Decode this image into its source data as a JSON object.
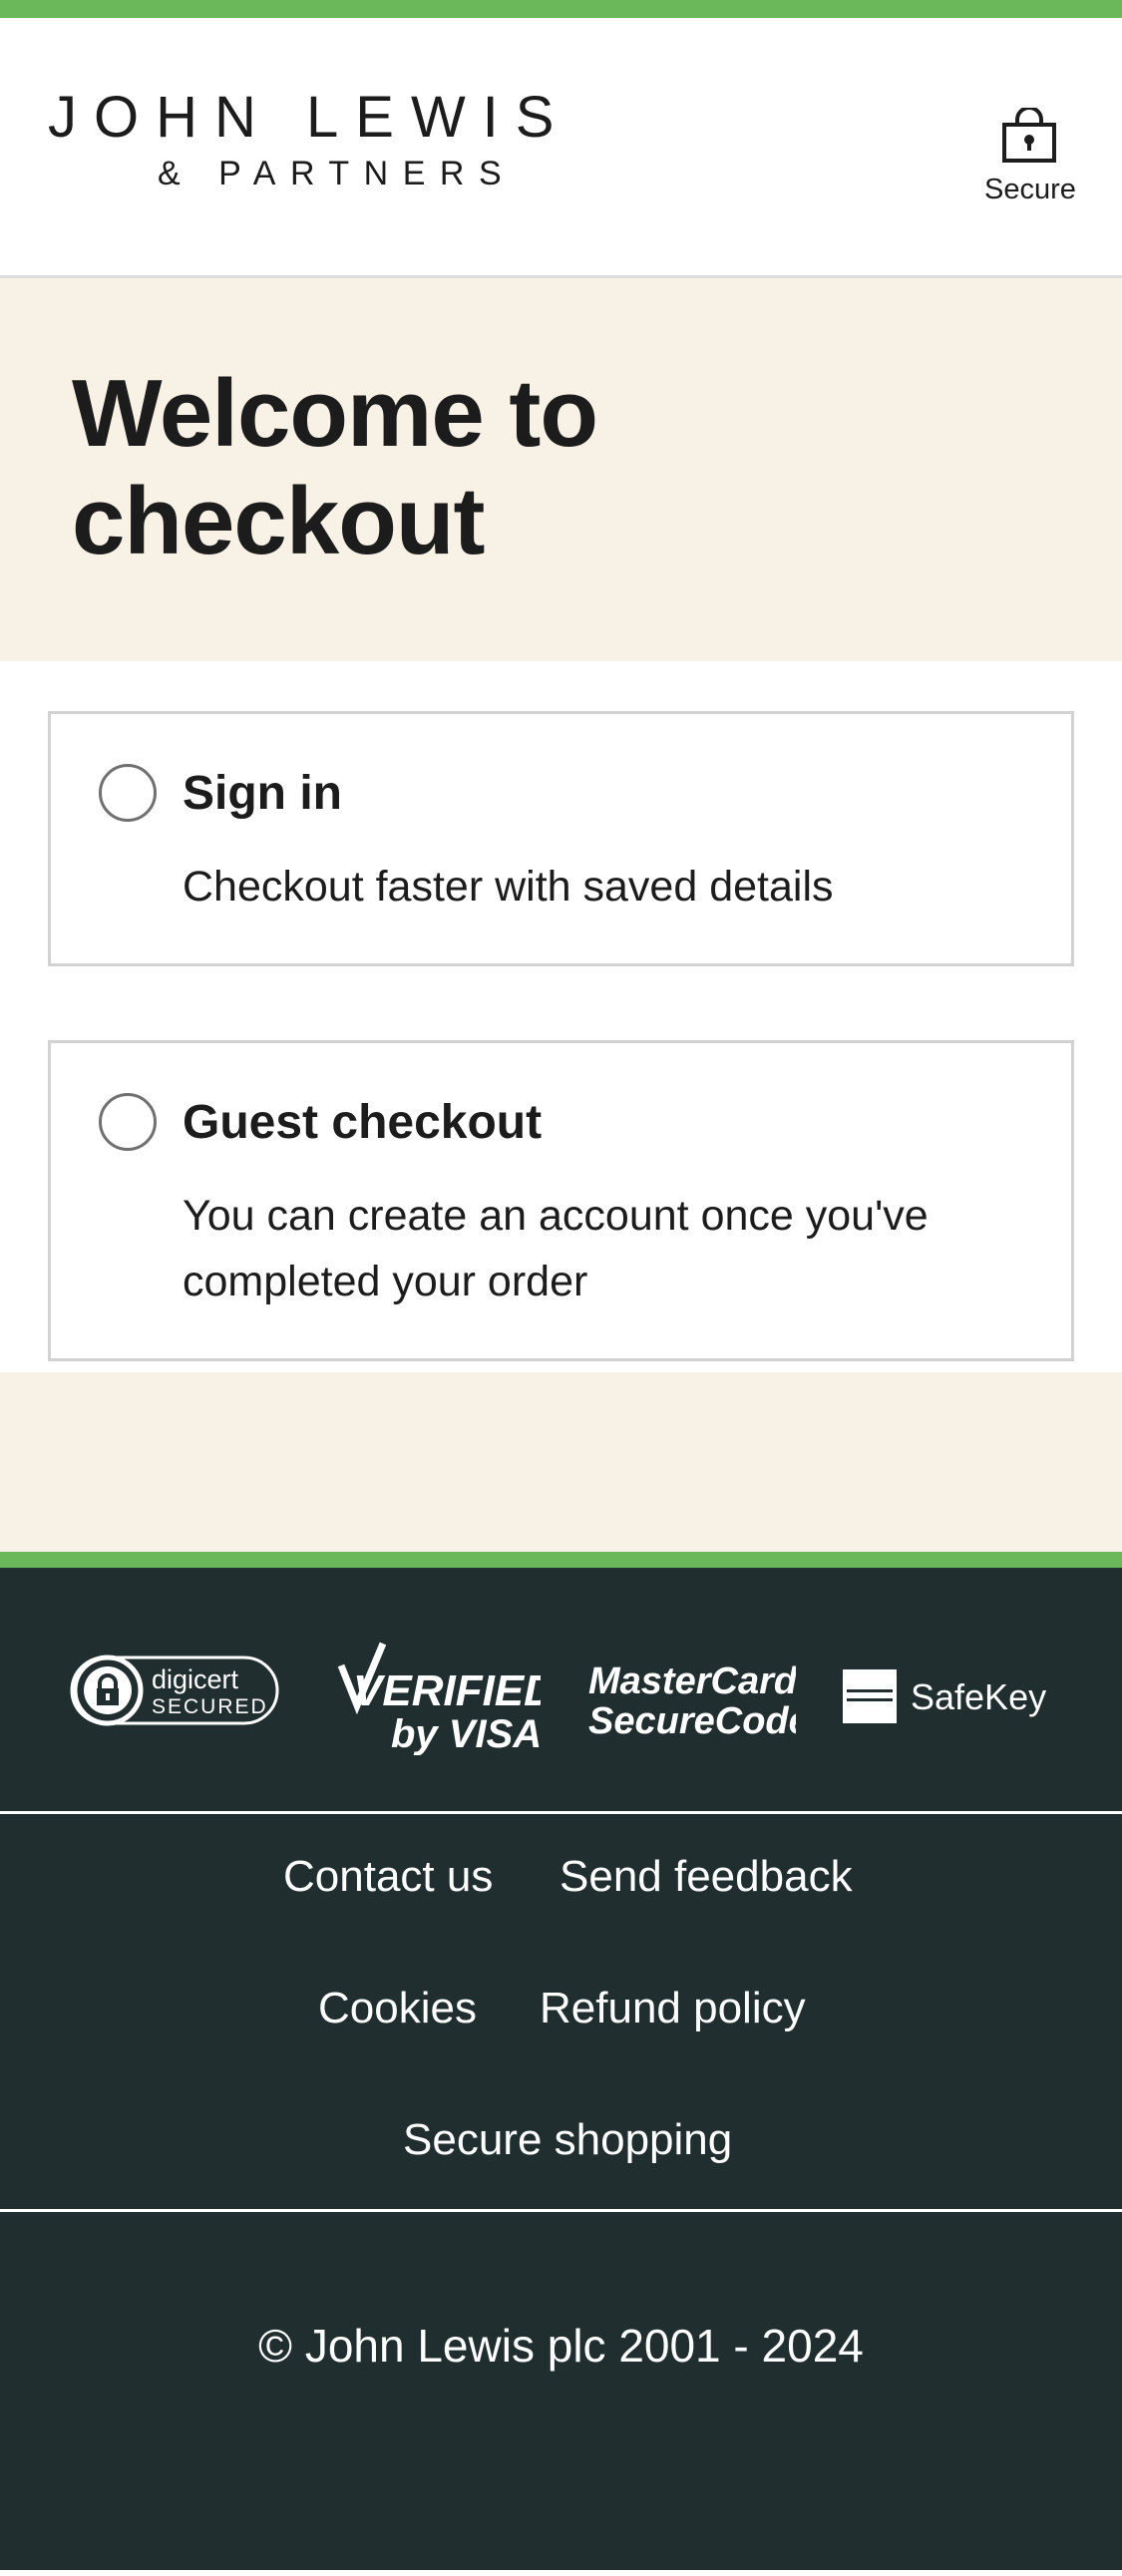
{
  "header": {
    "logo_line1": "JOHN LEWIS",
    "logo_line2": "& PARTNERS",
    "secure_label": "Secure"
  },
  "hero": {
    "title": "Welcome to checkout"
  },
  "options": [
    {
      "title": "Sign in",
      "description": "Checkout faster with saved details",
      "selected": false
    },
    {
      "title": "Guest checkout",
      "description": "You can create an account once you've completed your order",
      "selected": false
    }
  ],
  "footer": {
    "badges": {
      "digicert_top": "digicert",
      "digicert_bottom": "SECURED",
      "visa_top": "VERIFIED",
      "visa_bottom": "by VISA",
      "mastercard_top": "MasterCard.",
      "mastercard_bottom": "SecureCode.",
      "amex_label": "SafeKey"
    },
    "links": [
      "Contact us",
      "Send feedback",
      "Cookies",
      "Refund policy",
      "Secure shopping"
    ],
    "copyright": "© John Lewis plc 2001 - 2024"
  },
  "colors": {
    "accent_green": "#6ab85a",
    "cream": "#f8f1e6",
    "footer_dark": "#212e2f",
    "text": "#1c1c1c"
  }
}
